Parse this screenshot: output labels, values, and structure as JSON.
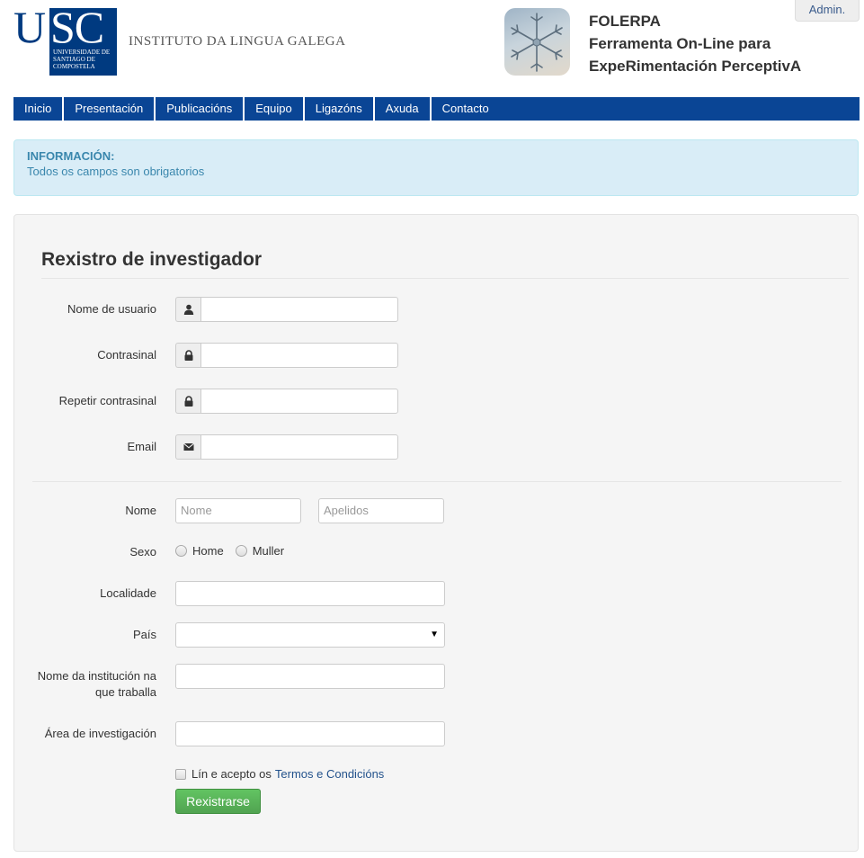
{
  "header": {
    "logo_letters": "USC",
    "logo_sub": "Universidade de Santiago de Compostela",
    "institute": "INSTITUTO DA LINGUA GALEGA",
    "app_title_lines": [
      "FOLERPA",
      "Ferramenta On-Line para",
      "ExpeRimentación PerceptivA"
    ],
    "admin_label": "Admin."
  },
  "nav": {
    "items": [
      "Inicio",
      "Presentación",
      "Publicacións",
      "Equipo",
      "Ligazóns",
      "Axuda",
      "Contacto"
    ]
  },
  "alert": {
    "title": "INFORMACIÓN:",
    "text": "Todos os campos son obrigatorios"
  },
  "form": {
    "title": "Rexistro de investigador",
    "fields": {
      "username_label": "Nome de usuario",
      "password_label": "Contrasinal",
      "repeat_password_label": "Repetir contrasinal",
      "email_label": "Email",
      "name_label": "Nome",
      "name_placeholder": "Nome",
      "surname_placeholder": "Apelidos",
      "sex_label": "Sexo",
      "sex_options": [
        "Home",
        "Muller"
      ],
      "locality_label": "Localidade",
      "country_label": "País",
      "institution_label_lines": [
        "Nome da institución na",
        "que traballa"
      ],
      "research_area_label": "Área de investigación"
    },
    "terms_text": "Lín e acepto os",
    "terms_link": "Termos e Condicións",
    "submit_label": "Rexistrarse"
  },
  "colors": {
    "nav_bg": "#0a4595",
    "usc_blue": "#003a80",
    "alert_bg": "#d9edf7",
    "alert_text": "#3a87ad",
    "submit_green": "#5bb75b"
  }
}
